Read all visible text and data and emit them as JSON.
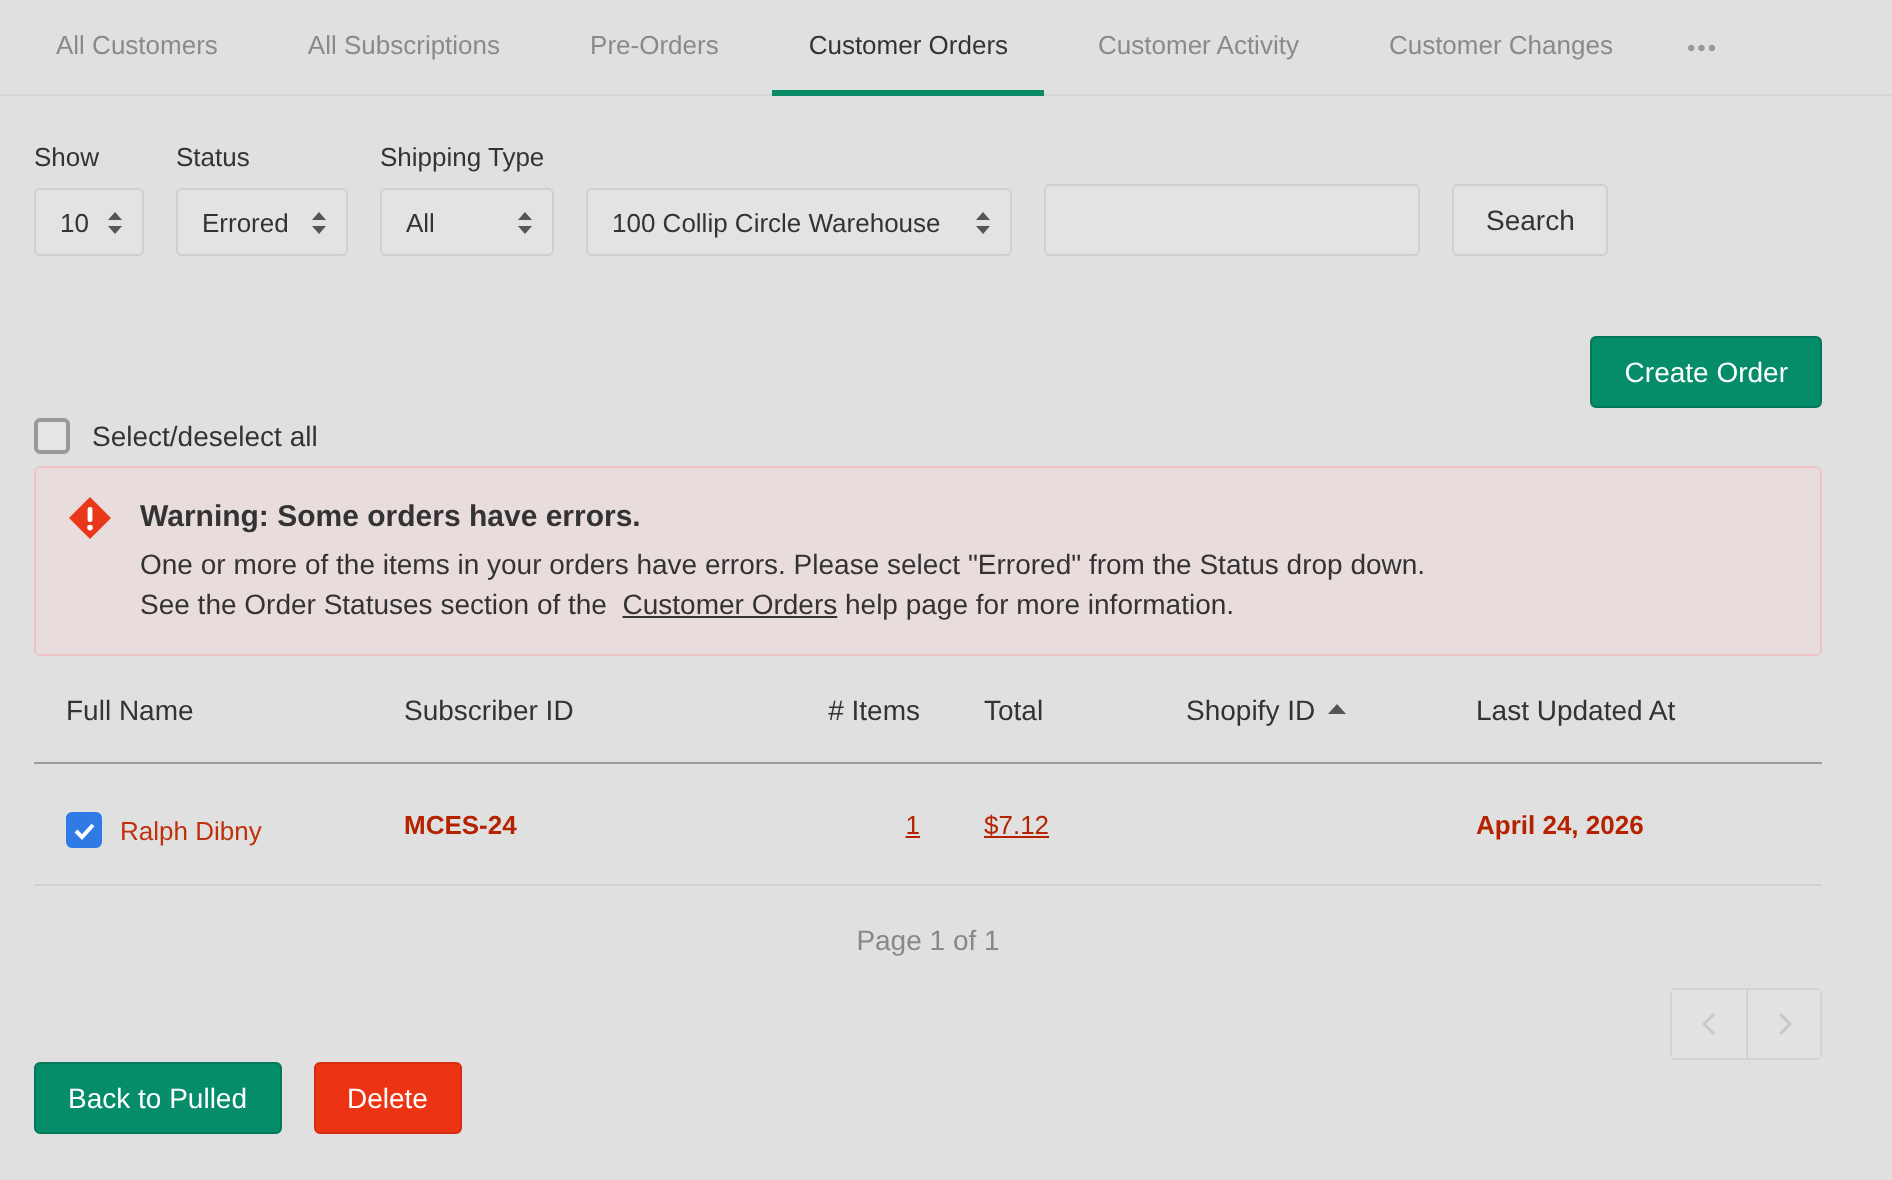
{
  "tabs": [
    {
      "label": "All Customers",
      "selected": false
    },
    {
      "label": "All Subscriptions",
      "selected": false
    },
    {
      "label": "Pre-Orders",
      "selected": false
    },
    {
      "label": "Customer Orders",
      "selected": true
    },
    {
      "label": "Customer Activity",
      "selected": false
    },
    {
      "label": "Customer Changes",
      "selected": false
    }
  ],
  "more_tabs": "•••",
  "filters": [
    {
      "label": "Show",
      "value": "10"
    },
    {
      "label": "Status",
      "value": "Errored"
    },
    {
      "label": "Shipping Type",
      "value": "All"
    },
    {
      "value": "100 Collip Circle Warehouse"
    }
  ],
  "search_button": "Search",
  "create_button": "Create Order",
  "select_all": {
    "label": "Select/deselect all",
    "checked": false
  },
  "alert": {
    "title": "Warning: Some orders have errors.",
    "line_1": "One or more of the items in your orders have errors. Please select \"Errored\" from the Status drop down.",
    "line_2_before": "See the Order Statuses section of the ",
    "line_2_link": "Customer Orders",
    "line_2_after": " help page for more information."
  },
  "table": {
    "columns": [
      {
        "label": "Full Name",
        "sorted": false
      },
      {
        "label": "Subscriber ID",
        "sorted": false
      },
      {
        "label": "# Items",
        "sorted": false
      },
      {
        "label": "Total",
        "sorted": false
      },
      {
        "label": "Shopify ID",
        "sorted": true
      },
      {
        "label": "Last Updated At",
        "sorted": false
      }
    ],
    "rows": [
      {
        "checked": true,
        "full_name": "Ralph Dibny",
        "subscriber_id": "MCES-24",
        "items": "1",
        "total": "$7.12",
        "last_updated_at": "April 24, 2026"
      }
    ]
  },
  "page_info": "Page 1 of 1",
  "pager": {
    "prev_disabled": true,
    "next_disabled": true
  },
  "actions": [
    {
      "label": "Back to Pulled",
      "kind": "primary"
    },
    {
      "label": "Delete",
      "kind": "danger"
    }
  ]
}
